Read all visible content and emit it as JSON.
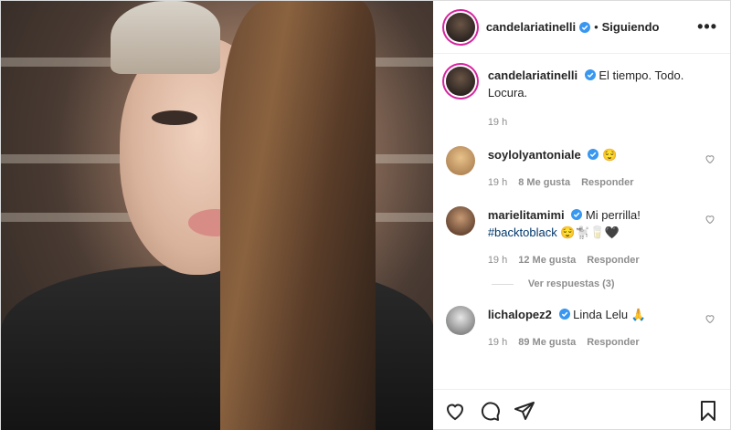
{
  "header": {
    "username": "candelariatinelli",
    "separator": "•",
    "follow_status": "Siguiendo",
    "more_label": "•••"
  },
  "caption": {
    "username": "candelariatinelli",
    "text": "El tiempo. Todo. Locura.",
    "time": "19 h"
  },
  "comments": [
    {
      "username": "soylolyantoniale",
      "text": "😌",
      "time": "19 h",
      "likes": "8 Me gusta",
      "reply": "Responder"
    },
    {
      "username": "marielitamimi",
      "text": "Mi perrilla!",
      "hashtag": "#backtoblack",
      "emojis": "😌🐩🥛🖤",
      "time": "19 h",
      "likes": "12 Me gusta",
      "reply": "Responder",
      "view_replies": "Ver respuestas (3)"
    },
    {
      "username": "lichalopez2",
      "text": "Linda Lelu 🙏",
      "time": "19 h",
      "likes": "89 Me gusta",
      "reply": "Responder"
    }
  ],
  "colors": {
    "verified": "#3897f0",
    "story_ring": "#d6249f",
    "muted_text": "#8e8e8e"
  },
  "icons": {
    "like": "heart-icon",
    "comment": "comment-icon",
    "share": "share-icon",
    "save": "bookmark-icon"
  }
}
